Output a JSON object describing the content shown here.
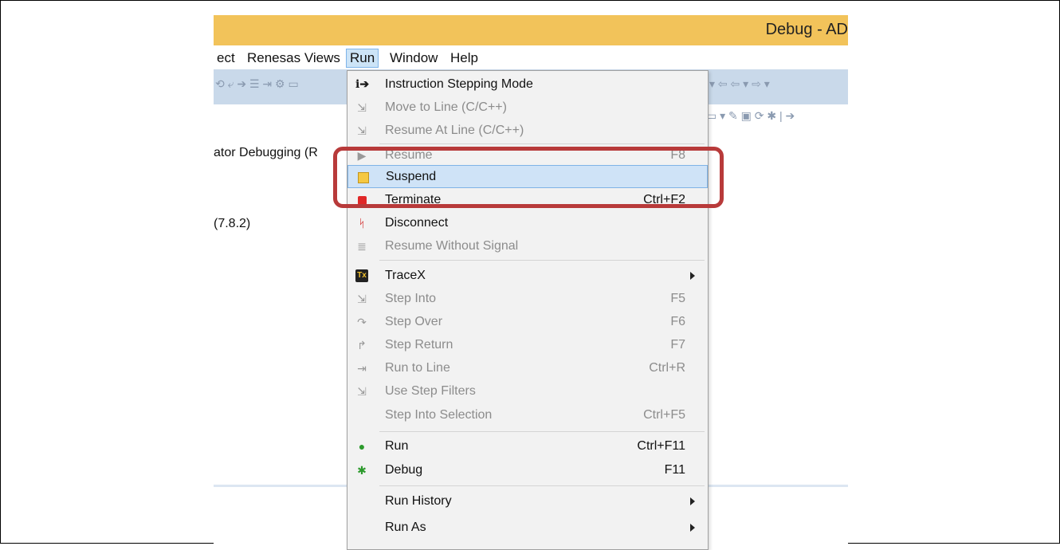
{
  "window": {
    "title": "Debug - AD"
  },
  "menubar": {
    "items": [
      {
        "label": "ect"
      },
      {
        "label": "Renesas Views"
      },
      {
        "label": "Run"
      },
      {
        "label": "Window"
      },
      {
        "label": "Help"
      }
    ]
  },
  "background": {
    "line1": "ator Debugging (R",
    "line2": "(7.8.2)"
  },
  "run_menu": {
    "items": [
      {
        "label": "Instruction Stepping Mode",
        "shortcut": "",
        "icon": "instruction-stepping-icon"
      },
      {
        "label": "Move to Line (C/C++)",
        "shortcut": "",
        "icon": "move-to-line-icon"
      },
      {
        "label": "Resume At Line (C/C++)",
        "shortcut": "",
        "icon": "resume-at-line-icon"
      },
      {
        "label": "Resume",
        "shortcut": "F8",
        "icon": "resume-icon"
      },
      {
        "label": "Suspend",
        "shortcut": "",
        "icon": "suspend-icon"
      },
      {
        "label": "Terminate",
        "shortcut": "Ctrl+F2",
        "icon": "terminate-icon"
      },
      {
        "label": "Disconnect",
        "shortcut": "",
        "icon": "disconnect-icon"
      },
      {
        "label": "Resume Without Signal",
        "shortcut": "",
        "icon": "resume-without-signal-icon"
      },
      {
        "label": "TraceX",
        "shortcut": "",
        "icon": "tracex-icon"
      },
      {
        "label": "Step Into",
        "shortcut": "F5",
        "icon": "step-into-icon"
      },
      {
        "label": "Step Over",
        "shortcut": "F6",
        "icon": "step-over-icon"
      },
      {
        "label": "Step Return",
        "shortcut": "F7",
        "icon": "step-return-icon"
      },
      {
        "label": "Run to Line",
        "shortcut": "Ctrl+R",
        "icon": "run-to-line-icon"
      },
      {
        "label": "Use Step Filters",
        "shortcut": "",
        "icon": "step-filters-icon"
      },
      {
        "label": "Step Into Selection",
        "shortcut": "Ctrl+F5",
        "icon": ""
      },
      {
        "label": "Run",
        "shortcut": "Ctrl+F11",
        "icon": "run-icon"
      },
      {
        "label": "Debug",
        "shortcut": "F11",
        "icon": "debug-icon"
      },
      {
        "label": "Run History",
        "shortcut": "",
        "icon": ""
      },
      {
        "label": "Run As",
        "shortcut": "",
        "icon": ""
      }
    ]
  },
  "icons": {
    "instruction": "i➔",
    "tracex": "Tx"
  },
  "colors": {
    "titlebar": "#f2c35a",
    "highlight": "#cfe3f7",
    "callout": "#b83a3a"
  }
}
